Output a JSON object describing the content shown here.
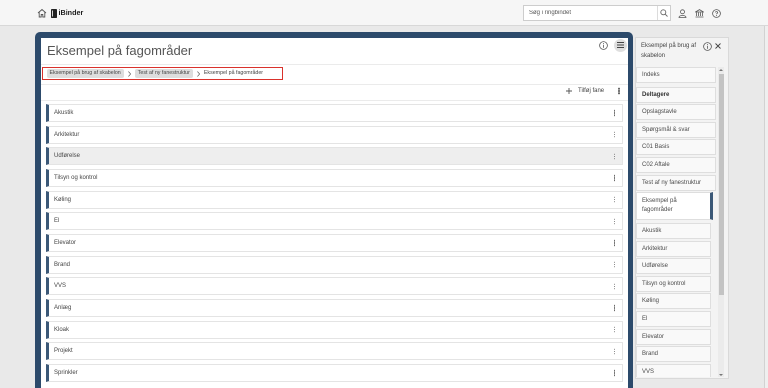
{
  "topbar": {
    "logo_text": "iBinder",
    "search_placeholder": "Søg i ringbindet"
  },
  "main": {
    "title": "Eksempel på fagområder",
    "breadcrumb": [
      "Eksempel på brug af skabelon",
      "Test af ny fanestruktur",
      "Eksempel på fagområder"
    ],
    "add_tab_label": "Tilføj fane",
    "rows": [
      "Akustik",
      "Arkitektur",
      "Udførelse",
      "Tilsyn og kontrol",
      "Køling",
      "El",
      "Elevator",
      "Brand",
      "VVS",
      "Anlæg",
      "Kloak",
      "Projekt",
      "Sprinkler"
    ],
    "hovered_row_index": 2
  },
  "sidebar": {
    "title": "Eksempel på brug af skabelon",
    "items": [
      "Indeks",
      "Deltagere",
      "Opslagstavle",
      "Spørgsmål & svar",
      "C01 Basis",
      "C02 Aftale",
      "Test af ny fanestruktur",
      "Eksempel på fagområder",
      "Akustik",
      "Arkitektur",
      "Udførelse",
      "Tilsyn og kontrol",
      "Køling",
      "El",
      "Elevator",
      "Brand",
      "VVS"
    ],
    "selected_index": 7
  },
  "icons": {
    "home": "home-icon",
    "logo": "ibinder-logo-icon",
    "search": "search-icon",
    "user": "user-icon",
    "organization": "bank-icon",
    "help": "help-icon",
    "info": "info-icon",
    "menu": "menu-icon",
    "add": "plus-icon",
    "row_menu": "kebab-icon",
    "breadcrumb_separator": "chevron-right-icon",
    "close": "close-icon"
  },
  "colors": {
    "frame": "#2c4a6b",
    "row_accent": "#3b5877",
    "breadcrumb_outline": "#d9322c",
    "hovered_row": "#eeeeee"
  }
}
